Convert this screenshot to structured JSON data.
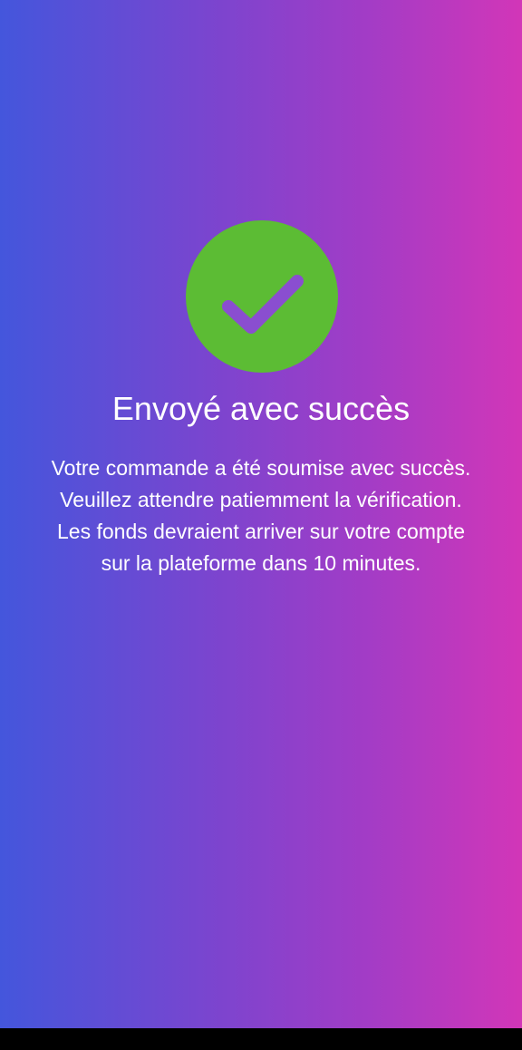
{
  "success": {
    "icon": "check-circle-icon",
    "icon_color": "#5cbc34",
    "check_color": "#8a4ed0",
    "title": "Envoyé avec succès",
    "message": "Votre commande a été soumise avec succès. Veuillez attendre patiemment la vérification. Les fonds devraient arriver sur votre compte sur la plateforme dans 10 minutes."
  },
  "theme": {
    "gradient_start": "#4456dc",
    "gradient_end": "#d236b8",
    "text_color": "#ffffff"
  }
}
